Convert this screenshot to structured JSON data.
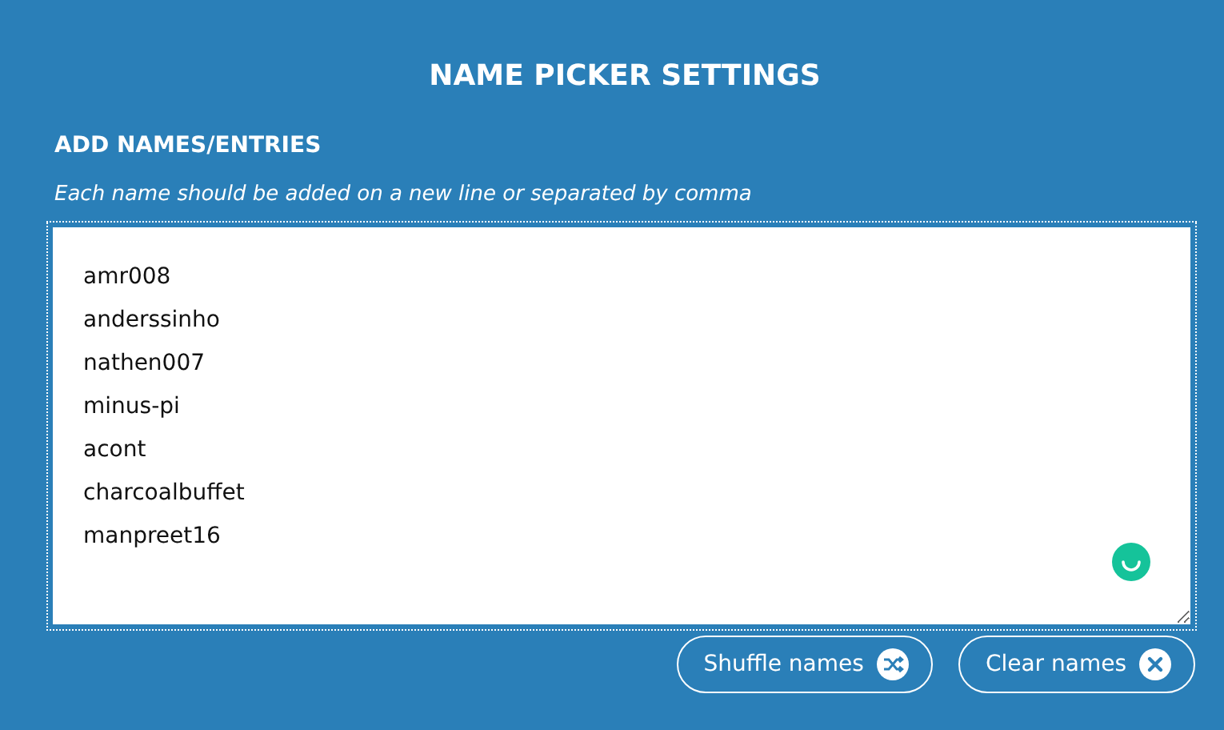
{
  "title": "NAME PICKER SETTINGS",
  "section": {
    "heading": "ADD NAMES/ENTRIES",
    "hint": "Each name should be added on a new line or separated by comma"
  },
  "names": [
    "amr008",
    "anderssinho",
    "nathen007",
    "minus-pi",
    "acont",
    "charcoalbuffet",
    "manpreet16"
  ],
  "buttons": [
    {
      "label": "Shuffle names",
      "kind": "shuffle"
    },
    {
      "label": "Clear names",
      "kind": "clear"
    }
  ]
}
